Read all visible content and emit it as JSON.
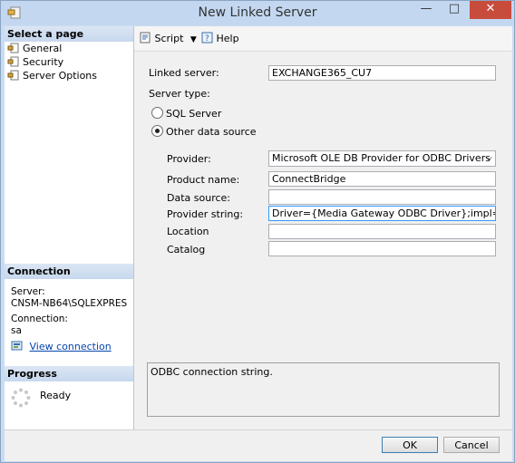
{
  "window": {
    "title": "New Linked Server",
    "minimize_glyph": "—",
    "maximize_glyph": "□",
    "close_glyph": "✕"
  },
  "left": {
    "select_page_header": "Select a page",
    "pages": [
      {
        "label": "General",
        "icon": "wrench-page-icon"
      },
      {
        "label": "Security",
        "icon": "wrench-page-icon"
      },
      {
        "label": "Server Options",
        "icon": "wrench-page-icon"
      }
    ],
    "connection_header": "Connection",
    "server_label": "Server:",
    "server_value": "CNSM-NB64\\SQLEXPRES",
    "connection_label": "Connection:",
    "connection_value": "sa",
    "view_connection_link": "View connection ",
    "progress_header": "Progress",
    "progress_status": "Ready"
  },
  "toolbar": {
    "script_label": "Script",
    "help_label": "Help"
  },
  "form": {
    "linked_server_label": "Linked server:",
    "linked_server_value": "EXCHANGE365_CU7",
    "server_type_label": "Server type:",
    "sql_server_label": "SQL Server",
    "other_source_label": "Other data source",
    "selected_server_type": "Other data source",
    "provider_label": "Provider:",
    "provider_value": "Microsoft OLE DB Provider for ODBC Drivers",
    "product_name_label": "Product name:",
    "product_name_value": "ConnectBridge",
    "data_source_label": "Data source:",
    "data_source_value": "",
    "provider_string_label": "Provider string:",
    "provider_string_value": "Driver={Media Gateway ODBC Driver};impl='CORE",
    "location_label": "Location",
    "location_value": "",
    "catalog_label": "Catalog",
    "catalog_value": ""
  },
  "description": "ODBC connection string.",
  "buttons": {
    "ok": "OK",
    "cancel": "Cancel"
  }
}
